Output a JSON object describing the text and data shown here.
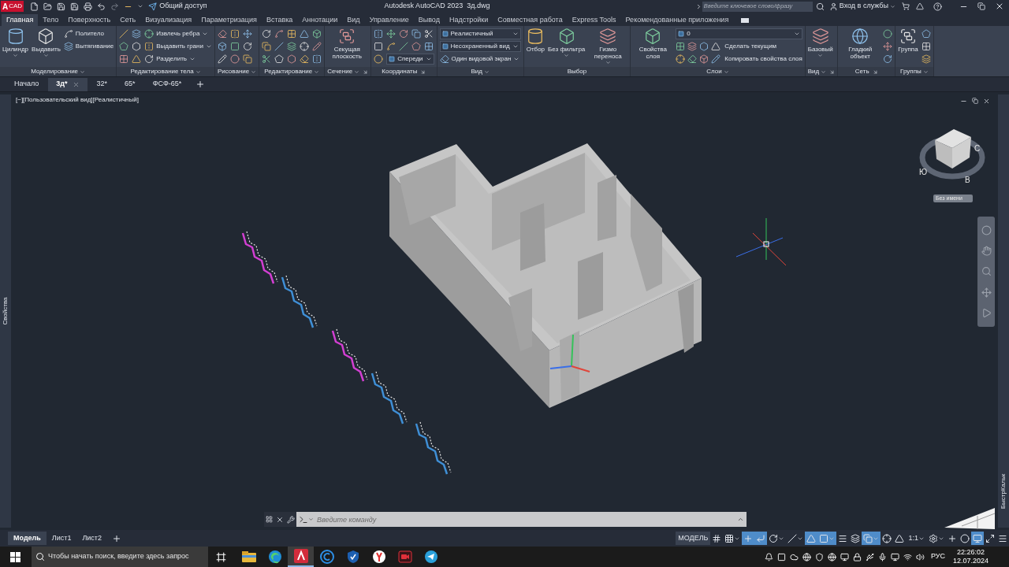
{
  "title_bar": {
    "logo_letter": "A",
    "logo_label": "CAD",
    "share": "Общий доступ",
    "title": "Autodesk AutoCAD 2023  3д.dwg",
    "search": {
      "placeholder": "Введите ключевое слово/фразу"
    },
    "sign_in": "Вход в службы"
  },
  "ribbon_tabs": [
    {
      "label": "Главная",
      "selected": true
    },
    {
      "label": "Тело",
      "selected": false
    },
    {
      "label": "Поверхность",
      "selected": false
    },
    {
      "label": "Сеть",
      "selected": false
    },
    {
      "label": "Визуализация",
      "selected": false
    },
    {
      "label": "Параметризация",
      "selected": false
    },
    {
      "label": "Вставка",
      "selected": false
    },
    {
      "label": "Аннотации",
      "selected": false
    },
    {
      "label": "Вид",
      "selected": false
    },
    {
      "label": "Управление",
      "selected": false
    },
    {
      "label": "Вывод",
      "selected": false
    },
    {
      "label": "Надстройки",
      "selected": false
    },
    {
      "label": "Совместная работа",
      "selected": false
    },
    {
      "label": "Express Tools",
      "selected": false
    },
    {
      "label": "Рекомендованные приложения",
      "selected": false
    }
  ],
  "ribbon_panels": [
    {
      "title": "Моделирование",
      "menu": true,
      "launcher": false,
      "items": [
        {
          "kind": "large",
          "label": "Цилиндр",
          "menu": true
        },
        {
          "kind": "large",
          "label": "Выдавить",
          "menu": true
        },
        {
          "kind": "stack",
          "rows": [
            {
              "kind": "small",
              "label": "Политело",
              "menu": false
            },
            {
              "kind": "small",
              "label": "Вытягивание",
              "menu": false
            }
          ]
        }
      ]
    },
    {
      "title": "Редактирование тела",
      "menu": true,
      "launcher": false,
      "items": [
        {
          "kind": "icons"
        },
        {
          "kind": "icons"
        },
        {
          "kind": "stack",
          "rows": [
            {
              "kind": "small",
              "label": "Извлечь ребра",
              "menu": true
            },
            {
              "kind": "small",
              "label": "Выдавить грани",
              "menu": true
            },
            {
              "kind": "small",
              "label": "Разделить",
              "menu": true
            }
          ]
        }
      ]
    },
    {
      "title": "Рисование",
      "menu": true,
      "launcher": false,
      "items": [
        {
          "kind": "icons"
        },
        {
          "kind": "icons"
        },
        {
          "kind": "icons"
        }
      ]
    },
    {
      "title": "Редактирование",
      "menu": true,
      "launcher": false,
      "items": [
        {
          "kind": "icons"
        },
        {
          "kind": "icons"
        },
        {
          "kind": "icons"
        },
        {
          "kind": "icons"
        },
        {
          "kind": "icons"
        }
      ]
    },
    {
      "title": "Сечение",
      "menu": true,
      "launcher": true,
      "items": [
        {
          "kind": "large",
          "label": "Секущая плоскость",
          "menu": false
        }
      ]
    },
    {
      "title": "Координаты",
      "menu": false,
      "launcher": true,
      "items": [
        {
          "kind": "icons"
        },
        {
          "kind": "stack",
          "rows": [
            {
              "kind": "icon_row"
            },
            {
              "kind": "icon_row"
            },
            {
              "kind": "combo",
              "value": "Спереди"
            }
          ]
        }
      ]
    },
    {
      "title": "Вид",
      "menu": true,
      "launcher": false,
      "items": [
        {
          "kind": "stack",
          "rows": [
            {
              "kind": "combo",
              "value": "Реалистичный"
            },
            {
              "kind": "combo",
              "value": "Несохраненный вид"
            },
            {
              "kind": "small",
              "label": "Один видовой экран",
              "menu": true
            }
          ]
        }
      ]
    },
    {
      "title": "Выбор",
      "menu": false,
      "launcher": false,
      "items": [
        {
          "kind": "large",
          "label": "Отбор",
          "menu": false
        },
        {
          "kind": "large",
          "label": "Без фильтра",
          "menu": true
        },
        {
          "kind": "large",
          "label": "Гизмо переноса",
          "menu": true
        }
      ]
    },
    {
      "title": "Слои",
      "menu": true,
      "launcher": false,
      "items": [
        {
          "kind": "large",
          "label": "Свойства слоя",
          "menu": false
        },
        {
          "kind": "stack",
          "rows": [
            {
              "kind": "combo",
              "value": "0"
            },
            {
              "kind": "tool_row",
              "label": "Сделать текущим"
            },
            {
              "kind": "tool_row",
              "label": "Копировать свойства слоя"
            }
          ]
        }
      ]
    },
    {
      "title": "Вид",
      "menu": true,
      "launcher": true,
      "items": [
        {
          "kind": "large",
          "label": "Базовый",
          "menu": true
        }
      ]
    },
    {
      "title": "Сеть",
      "menu": false,
      "launcher": true,
      "items": [
        {
          "kind": "large",
          "label": "Гладкий объект",
          "menu": false
        },
        {
          "kind": "icons"
        }
      ]
    },
    {
      "title": "Группы",
      "menu": true,
      "launcher": false,
      "items": [
        {
          "kind": "large",
          "label": "Группа",
          "menu": false
        },
        {
          "kind": "icons"
        }
      ]
    }
  ],
  "file_tabs": [
    {
      "label": "Начало",
      "selected": false
    },
    {
      "label": "3д*",
      "selected": true
    },
    {
      "label": "32*",
      "selected": false
    },
    {
      "label": "65*",
      "selected": false
    },
    {
      "label": "ФСФ-65*",
      "selected": false
    }
  ],
  "viewport": {
    "label": "[−][Пользовательский вид][Реалистичный]",
    "compass": [
      "С",
      "В",
      "Ю"
    ],
    "view_name": "Без имени"
  },
  "side_palettes": {
    "left": "Свойства",
    "right": "БыстрКальк"
  },
  "command_line": {
    "placeholder": "Введите команду"
  },
  "layout_tabs": [
    {
      "label": "Модель",
      "selected": true
    },
    {
      "label": "Лист1",
      "selected": false
    },
    {
      "label": "Лист2",
      "selected": false
    }
  ],
  "status_bar": {
    "space": "МОДЕЛЬ",
    "scale": "1:1",
    "tools": [
      {
        "on": false,
        "menu": false
      },
      {
        "on": false,
        "menu": true
      },
      {
        "on": true,
        "menu": false
      },
      {
        "on": true,
        "menu": false
      },
      {
        "on": false,
        "menu": true
      },
      {
        "on": false,
        "menu": true
      },
      {
        "on": true,
        "menu": false
      },
      {
        "on": true,
        "menu": true
      },
      {
        "on": false,
        "menu": false
      },
      {
        "on": false,
        "menu": false
      },
      {
        "on": true,
        "menu": true
      },
      {
        "on": false,
        "menu": false
      },
      {
        "on": false,
        "menu": false
      }
    ],
    "tools_after": [
      {
        "on": false,
        "menu": true
      },
      {
        "on": false,
        "menu": false
      },
      {
        "on": false,
        "menu": false
      },
      {
        "on": true,
        "menu": false
      },
      {
        "on": false,
        "menu": false
      },
      {
        "on": false,
        "menu": false
      }
    ]
  },
  "taskbar": {
    "search": {
      "placeholder": "Чтобы начать поиск, введите здесь запрос"
    },
    "apps": [
      {
        "kind": "folder",
        "selected": false
      },
      {
        "kind": "browser",
        "selected": false
      },
      {
        "kind": "cad",
        "selected": true
      },
      {
        "kind": "cleaner",
        "selected": false
      },
      {
        "kind": "shield",
        "selected": false
      },
      {
        "kind": "yandex",
        "selected": false
      },
      {
        "kind": "recorder",
        "selected": false
      },
      {
        "kind": "messenger",
        "selected": false
      }
    ],
    "language": "РУС",
    "time": "22:26:02",
    "date": "12.07.2024"
  }
}
